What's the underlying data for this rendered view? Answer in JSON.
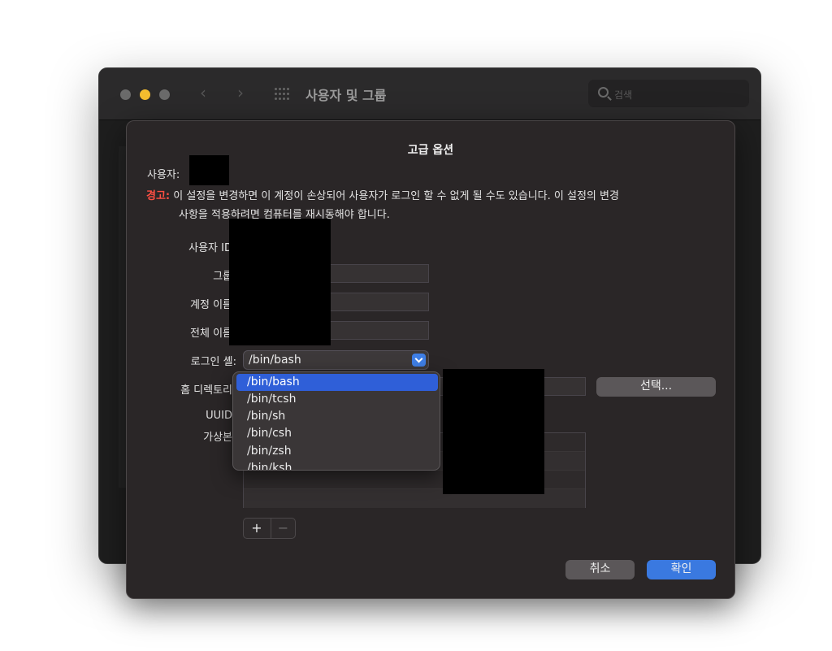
{
  "window": {
    "title": "사용자 및 그룹",
    "search_placeholder": "검색",
    "nav_back": "‹",
    "nav_forward": "›"
  },
  "sheet": {
    "title": "고급 옵션",
    "user_label": "사용자:",
    "warning_label": "경고:",
    "warning_text_line1": "이 설정을 변경하면 이 계정이 손상되어 사용자가 로그인 할 수 없게 될 수도 있습니다. 이 설정의 변경",
    "warning_text_line2": "사항을 적용하려면 컴퓨터를 재시동해야 합니다.",
    "fields": {
      "user_id_label": "사용자 ID",
      "group_label": "그룹",
      "account_name_label": "계정 이름",
      "full_name_label": "전체 이름",
      "login_shell_label": "로그인 셸:",
      "home_dir_label": "홈 디렉토리",
      "uuid_label": "UUID",
      "aliases_label": "가상본"
    },
    "login_shell_value": "/bin/bash",
    "choose_button": "선택...",
    "plus_label": "+",
    "minus_label": "−",
    "cancel_button": "취소",
    "ok_button": "확인"
  },
  "shell_menu": {
    "items": [
      "/bin/bash",
      "/bin/tcsh",
      "/bin/sh",
      "/bin/csh",
      "/bin/zsh",
      "/bin/ksh"
    ],
    "selected": "/bin/bash"
  }
}
